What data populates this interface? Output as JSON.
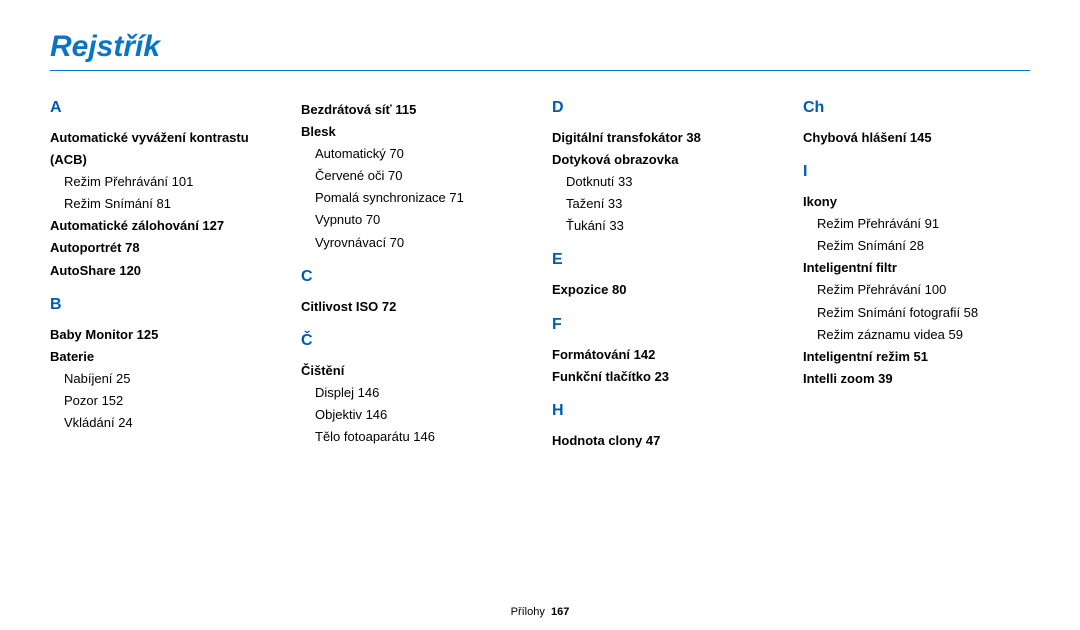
{
  "title": "Rejstřík",
  "footer": {
    "section": "Přílohy",
    "page": "167"
  },
  "cols": [
    {
      "sections": [
        {
          "letter": "A",
          "entries": [
            {
              "bold": "Automatické vyvážení kontrastu (ACB)",
              "subs": [
                "Režim Přehrávání  101",
                "Režim Snímání  81"
              ]
            },
            {
              "bold": "Automatické zálohování  127"
            },
            {
              "bold": "Autoportrét  78"
            },
            {
              "bold": "AutoShare  120"
            }
          ]
        },
        {
          "letter": "B",
          "entries": [
            {
              "bold": "Baby Monitor  125"
            },
            {
              "bold": "Baterie",
              "subs": [
                "Nabíjení  25",
                "Pozor  152",
                "Vkládání  24"
              ]
            }
          ]
        }
      ]
    },
    {
      "sections": [
        {
          "letter": null,
          "entries": [
            {
              "bold": "Bezdrátová síť  115"
            },
            {
              "bold": "Blesk",
              "subs": [
                "Automatický  70",
                "Červené oči  70",
                "Pomalá synchronizace  71",
                "Vypnuto  70",
                "Vyrovnávací  70"
              ]
            }
          ]
        },
        {
          "letter": "C",
          "entries": [
            {
              "bold": "Citlivost ISO  72"
            }
          ]
        },
        {
          "letter": "Č",
          "entries": [
            {
              "bold": "Čištění",
              "subs": [
                "Displej  146",
                "Objektiv  146",
                "Tělo fotoaparátu  146"
              ]
            }
          ]
        }
      ]
    },
    {
      "sections": [
        {
          "letter": "D",
          "entries": [
            {
              "bold": "Digitální transfokátor  38"
            },
            {
              "bold": "Dotyková obrazovka",
              "subs": [
                "Dotknutí  33",
                "Tažení  33",
                "Ťukání  33"
              ]
            }
          ]
        },
        {
          "letter": "E",
          "entries": [
            {
              "bold": "Expozice  80"
            }
          ]
        },
        {
          "letter": "F",
          "entries": [
            {
              "bold": "Formátování  142"
            },
            {
              "bold": "Funkční tlačítko  23"
            }
          ]
        },
        {
          "letter": "H",
          "entries": [
            {
              "bold": "Hodnota clony  47"
            }
          ]
        }
      ]
    },
    {
      "sections": [
        {
          "letter": "Ch",
          "entries": [
            {
              "bold": "Chybová hlášení  145"
            }
          ]
        },
        {
          "letter": "I",
          "entries": [
            {
              "bold": "Ikony",
              "subs": [
                "Režim Přehrávání  91",
                "Režim Snímání  28"
              ]
            },
            {
              "bold": "Inteligentní filtr",
              "subs": [
                "Režim Přehrávání  100",
                "Režim Snímání fotografií  58",
                "Režim záznamu videa  59"
              ]
            },
            {
              "bold": "Inteligentní režim  51"
            },
            {
              "bold": "Intelli zoom  39"
            }
          ]
        }
      ]
    }
  ]
}
